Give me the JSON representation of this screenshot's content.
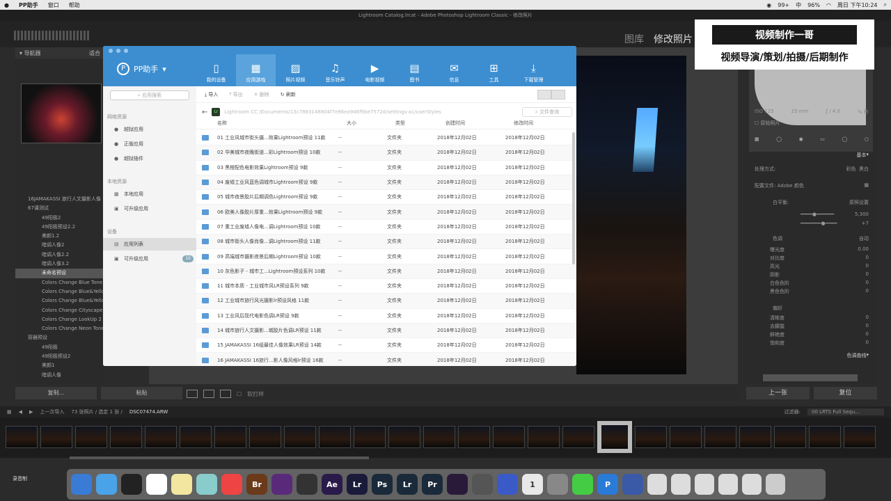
{
  "menubar": {
    "app": "PP助手",
    "items": [
      "窗口",
      "帮助"
    ],
    "battery": "96%",
    "notif": "99+",
    "clock": "周日 下午10:24",
    "ime": "中"
  },
  "window_title": "Lightroom Catalog.lrcat - Adobe Photoshop Lightroom Classic - 修改照片",
  "lr": {
    "modules": [
      "图库",
      "修改照片"
    ],
    "navigator": "导航器",
    "fit": "适合",
    "buttons_left": [
      "复制...",
      "粘贴"
    ],
    "buttons_right": [
      "上一张",
      "复位"
    ],
    "softproof": "软打样",
    "basic": "基本",
    "tone_curve": "色调曲线",
    "process": "处理方式:",
    "color_bw": [
      "彩色",
      "黑白"
    ],
    "profile": "配置文件:",
    "profile_val": "Adobe 颜色",
    "wb": "白平衡:",
    "wb_val": "原照设置",
    "temp_val": "5,300",
    "tint_val": "+7",
    "tone": "色调",
    "auto": "自动",
    "presence": "偏好",
    "exif": [
      "ISO 125",
      "25 mm",
      "ƒ / 4.0",
      "¼ 秒"
    ],
    "orig": "原始照片",
    "tone_sliders": [
      "曝光度",
      "对比度",
      "高光",
      "阴影",
      "白色色阶",
      "黑色色阶"
    ],
    "tone_vals": [
      "0.00",
      "0",
      "0",
      "0",
      "0",
      "0"
    ],
    "presence_sliders": [
      "清晰度",
      "去朦胧",
      "鲜艳度",
      "饱和度"
    ],
    "presence_vals": [
      "0",
      "0",
      "0",
      "0"
    ]
  },
  "tree": [
    {
      "label": "16JAMAKASSI 旅行人文摄影人像",
      "ind": false
    },
    {
      "label": "67课测试",
      "ind": false
    },
    {
      "label": "49阳极2",
      "ind": true
    },
    {
      "label": "49阳极预设2.2",
      "ind": true
    },
    {
      "label": "美颜1.2",
      "ind": true
    },
    {
      "label": "暗调人像2",
      "ind": true
    },
    {
      "label": "暗调人像2.2",
      "ind": true
    },
    {
      "label": "暗调人像3.2",
      "ind": true
    },
    {
      "label": "未命名预设",
      "ind": true,
      "sel": true
    },
    {
      "label": "Colors Change Blue Tone",
      "ind": true
    },
    {
      "label": "Colors Change Blue&Yellow",
      "ind": true
    },
    {
      "label": "Colors Change Blue&Yellow2",
      "ind": true
    },
    {
      "label": "Colors Change Cityscape",
      "ind": true
    },
    {
      "label": "Colors Change LookUp 2",
      "ind": true
    },
    {
      "label": "Colors Change Neon Tone",
      "ind": true
    },
    {
      "label": "容器预设",
      "ind": false
    },
    {
      "label": "49阳极",
      "ind": true
    },
    {
      "label": "49阳极预设2",
      "ind": true
    },
    {
      "label": "美颜1",
      "ind": true
    },
    {
      "label": "暗调人像",
      "ind": true
    }
  ],
  "filmbar": {
    "prev": "上一次导入",
    "count": "73 张照片 / 选定 1 张 /",
    "file": "DSC07474.ARW",
    "filter": "过滤器:",
    "filter_val": "00 LRTS Full Sequ..."
  },
  "dock": {
    "rec": "录音制"
  },
  "brand": {
    "title": "视频制作一哥",
    "sub": "视频导演/策划/拍摄/后期制作"
  },
  "pp": {
    "name": "PP助手",
    "tabs": [
      {
        "label": "我的设备",
        "g": "▯"
      },
      {
        "label": "应用游戏",
        "g": "▦",
        "act": true
      },
      {
        "label": "照片视频",
        "g": "▨"
      },
      {
        "label": "音乐铃声",
        "g": "♫"
      },
      {
        "label": "电影视频",
        "g": "▶"
      },
      {
        "label": "图书",
        "g": "▤"
      },
      {
        "label": "信息",
        "g": "✉"
      },
      {
        "label": "工具",
        "g": "⊞"
      },
      {
        "label": "下载管理",
        "g": "⤓"
      }
    ],
    "search_placeholder": "应用搜索",
    "groups": [
      "网络资源",
      "本地资源",
      "设备"
    ],
    "side_net": [
      {
        "label": "越狱应用",
        "icon": "●"
      },
      {
        "label": "正版应用",
        "icon": "●"
      },
      {
        "label": "越狱插件",
        "icon": "●"
      }
    ],
    "side_local": [
      {
        "label": "本地应用",
        "icon": "▦"
      },
      {
        "label": "可升级应用",
        "icon": "▣"
      }
    ],
    "side_dev": [
      {
        "label": "应用列表",
        "icon": "▤",
        "act": true
      },
      {
        "label": "可升级应用",
        "icon": "▣",
        "badge": "10"
      }
    ],
    "tools": [
      "导入",
      "导出",
      "删除",
      "刷新"
    ],
    "path": "Lightroom CC /Documents/13c7883148804f7e86ea946f9be7572d/settings-ac/userStyles",
    "file_search": "文件查询",
    "cols": [
      "名称",
      "大小",
      "类型",
      "创建时间",
      "修改时间"
    ],
    "rows": [
      [
        "01 工业风城市街头摄...效果Lightroom预设 11款",
        "--",
        "文件夹",
        "2018年12月02日",
        "2018年12月02日"
      ],
      [
        "02 华美城市夜晚街道...彩Lightroom预设 10款",
        "--",
        "文件夹",
        "2018年12月02日",
        "2018年12月02日"
      ],
      [
        "03 黑橙配色电影效果Lightroom预设 9款",
        "--",
        "文件夹",
        "2018年12月02日",
        "2018年12月02日"
      ],
      [
        "04 废墟工业风蓝色调城市Lightroom预设 9款",
        "--",
        "文件夹",
        "2018年12月02日",
        "2018年12月02日"
      ],
      [
        "05 城市夜景胶片后期调色Lightroom预设 9款",
        "--",
        "文件夹",
        "2018年12月02日",
        "2018年12月02日"
      ],
      [
        "06 欧美人像胶片厚重...效果Lightroom预设 9款",
        "--",
        "文件夹",
        "2018年12月02日",
        "2018年12月02日"
      ],
      [
        "07 重工业废墟人像电...调Lightroom预设 10款",
        "--",
        "文件夹",
        "2018年12月02日",
        "2018年12月02日"
      ],
      [
        "08 城市街头人像肖像...调Lightroom预设 11款",
        "--",
        "文件夹",
        "2018年12月02日",
        "2018年12月02日"
      ],
      [
        "09 高端城市摄影夜景后期Lightroom预设 10款",
        "--",
        "文件夹",
        "2018年12月02日",
        "2018年12月02日"
      ],
      [
        "10 灰色影子 - 城市工...Lightroom预设系列 10款",
        "--",
        "文件夹",
        "2018年12月02日",
        "2018年12月02日"
      ],
      [
        "11 城市本质 - 工业城市风LR预设系列 9款",
        "--",
        "文件夹",
        "2018年12月02日",
        "2018年12月02日"
      ],
      [
        "12 工业城市旅行风光摄影lr预设风格 11款",
        "--",
        "文件夹",
        "2018年12月02日",
        "2018年12月02日"
      ],
      [
        "13 工业风后现代电影色调LR预设 9款",
        "--",
        "文件夹",
        "2018年12月02日",
        "2018年12月02日"
      ],
      [
        "14 城市旅行人文摄影...城胶片色调LR预设 11款",
        "--",
        "文件夹",
        "2018年12月02日",
        "2018年12月02日"
      ],
      [
        "15 JAMAKASSI 16组最佳人像效果LR预设 14款",
        "--",
        "文件夹",
        "2018年12月02日",
        "2018年12月02日"
      ],
      [
        "16 JAMAKASSI 16旅行...影人像风格lr预设 16款",
        "--",
        "文件夹",
        "2018年12月02日",
        "2018年12月02日"
      ]
    ]
  }
}
